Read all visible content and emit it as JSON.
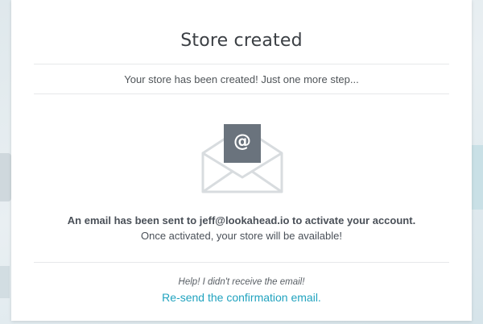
{
  "modal": {
    "title": "Store created",
    "subtitle": "Your store has been created! Just one more step...",
    "message_bold": "An email has been sent to jeff@lookahead.io to activate your account.",
    "message_normal": "Once activated, your store will be available!",
    "help_text": "Help! I didn't receive the email!",
    "resend_link": "Re-send the confirmation email.",
    "envelope_symbol": "@"
  },
  "icons": {
    "envelope": "envelope-with-letter-icon"
  },
  "colors": {
    "link": "#21a3bf",
    "letter": "#6a737d",
    "envelope_outline": "#d8dcdf",
    "text": "#4a5058"
  }
}
